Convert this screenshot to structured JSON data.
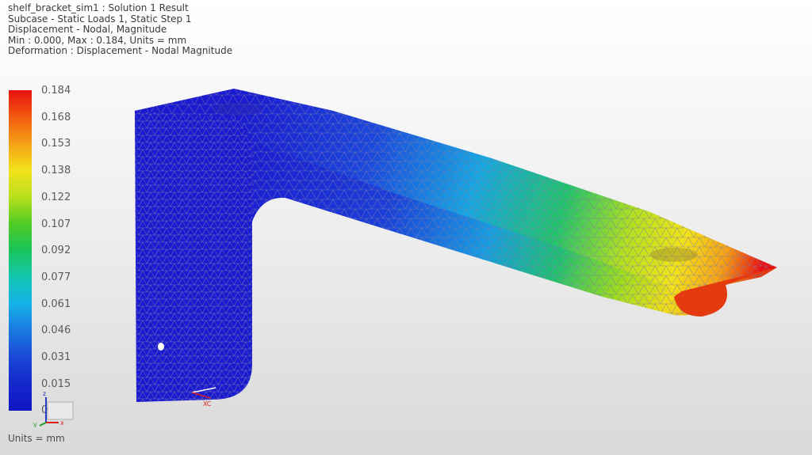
{
  "header": {
    "line1": "shelf_bracket_sim1 : Solution 1 Result",
    "line2": "Subcase - Static Loads 1, Static Step 1",
    "line3": "Displacement - Nodal, Magnitude",
    "line4": "Min : 0.000, Max : 0.184, Units = mm",
    "line5": "Deformation : Displacement - Nodal Magnitude"
  },
  "legend": {
    "ticks": [
      "0.184",
      "0.168",
      "0.153",
      "0.138",
      "0.122",
      "0.107",
      "0.092",
      "0.077",
      "0.061",
      "0.046",
      "0.031",
      "0.015",
      "0.000"
    ],
    "colors": [
      "#e81010",
      "#f25a10",
      "#f5a016",
      "#f2e21a",
      "#b9e01c",
      "#52cc24",
      "#18c45a",
      "#14c6b0",
      "#14b2e6",
      "#1a78e0",
      "#1a48d8",
      "#1428cc",
      "#1014c4"
    ],
    "units": "Units = mm"
  },
  "triad": {
    "x_label": "x",
    "y_label": "y",
    "z_label": "z",
    "xc_label": "XC"
  },
  "model": {
    "name": "shelf bracket",
    "mesh": "tetrahedral",
    "min_color": "#1414c8",
    "max_color": "#e81010"
  }
}
